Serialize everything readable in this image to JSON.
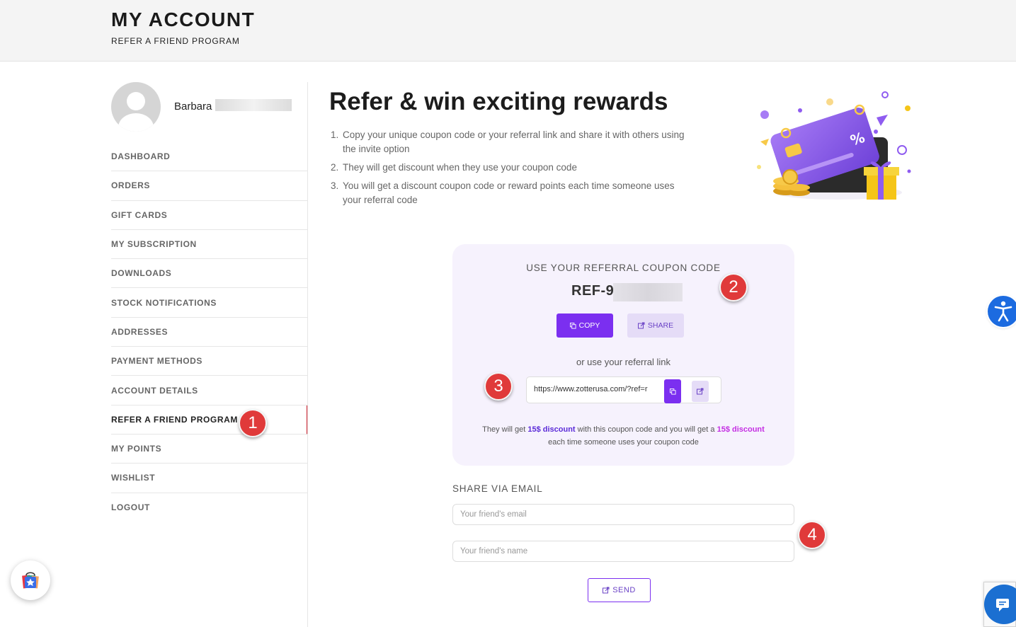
{
  "header": {
    "title": "MY ACCOUNT",
    "subtitle": "REFER A FRIEND PROGRAM"
  },
  "user": {
    "first_name": "Barbara"
  },
  "sidebar": {
    "items": [
      {
        "label": "DASHBOARD"
      },
      {
        "label": "ORDERS"
      },
      {
        "label": "GIFT CARDS"
      },
      {
        "label": "MY SUBSCRIPTION"
      },
      {
        "label": "DOWNLOADS"
      },
      {
        "label": "STOCK NOTIFICATIONS"
      },
      {
        "label": "ADDRESSES"
      },
      {
        "label": "PAYMENT METHODS"
      },
      {
        "label": "ACCOUNT DETAILS"
      },
      {
        "label": "REFER A FRIEND PROGRAM",
        "active": true
      },
      {
        "label": "MY POINTS"
      },
      {
        "label": "WISHLIST"
      },
      {
        "label": "LOGOUT"
      }
    ]
  },
  "main": {
    "heading": "Refer & win exciting rewards",
    "steps": [
      {
        "num": "1.",
        "text": "Copy your unique coupon code or your referral link and share it with others using the invite option"
      },
      {
        "num": "2.",
        "text": "They will get discount when they use your coupon code"
      },
      {
        "num": "3.",
        "text": "You will get a discount coupon code or reward points each time someone uses your referral code"
      }
    ]
  },
  "coupon": {
    "label": "USE YOUR REFERRAL COUPON CODE",
    "code_visible": "REF-9",
    "copy_label": "COPY",
    "share_label": "SHARE",
    "or_text": "or use your referral link",
    "link": "https://www.zotterusa.com/?ref=r",
    "note_part1": "They will get ",
    "note_discount_friend": "15$ discount",
    "note_part2": " with this coupon code and you will get a ",
    "note_discount_you": "15$ discount",
    "note_part3": "each time someone uses your coupon code"
  },
  "share_email": {
    "heading": "SHARE VIA EMAIL",
    "email_placeholder": "Your friend's email",
    "name_placeholder": "Your friend's name",
    "send_label": "SEND"
  },
  "markers": [
    "1",
    "2",
    "3",
    "4"
  ],
  "colors": {
    "accent_purple": "#7b2ff0",
    "light_purple": "#e5dcf7",
    "card_bg": "#f6f2fd",
    "active_indicator": "#cc1e2c",
    "marker_red": "#e03a3a",
    "accessibility_blue": "#1c6be0"
  },
  "icons": [
    "copy-icon",
    "share-icon",
    "accessibility-icon",
    "chat-icon",
    "loyalty-bag-icon"
  ]
}
